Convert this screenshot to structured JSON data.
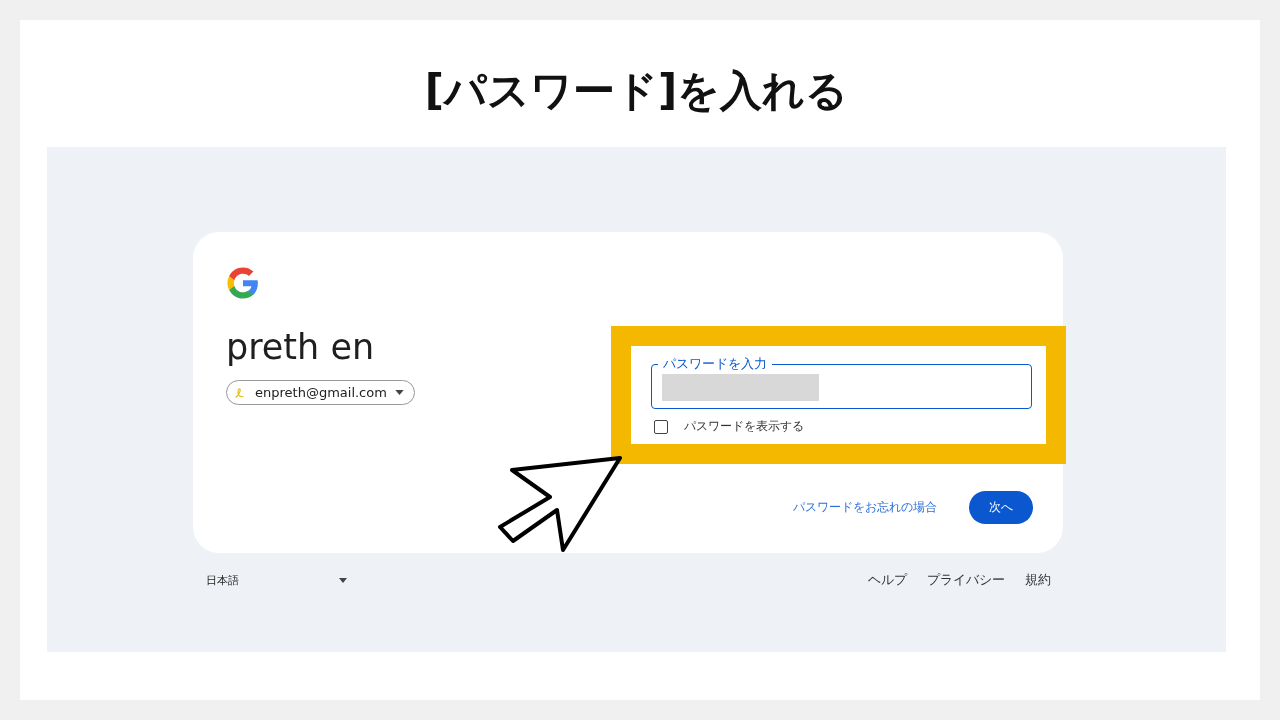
{
  "slide_title": "[パスワード]を入れる",
  "signin": {
    "account_name": "preth en",
    "account_email": "enpreth@gmail.com",
    "password_field": {
      "label": "パスワードを入力",
      "masked": true
    },
    "show_password": {
      "label": "パスワードを表示する",
      "checked": false
    },
    "forgot_link": "パスワードをお忘れの場合",
    "next_button": "次へ"
  },
  "footer": {
    "language": "日本語",
    "links": [
      "ヘルプ",
      "プライバシー",
      "規約"
    ]
  }
}
